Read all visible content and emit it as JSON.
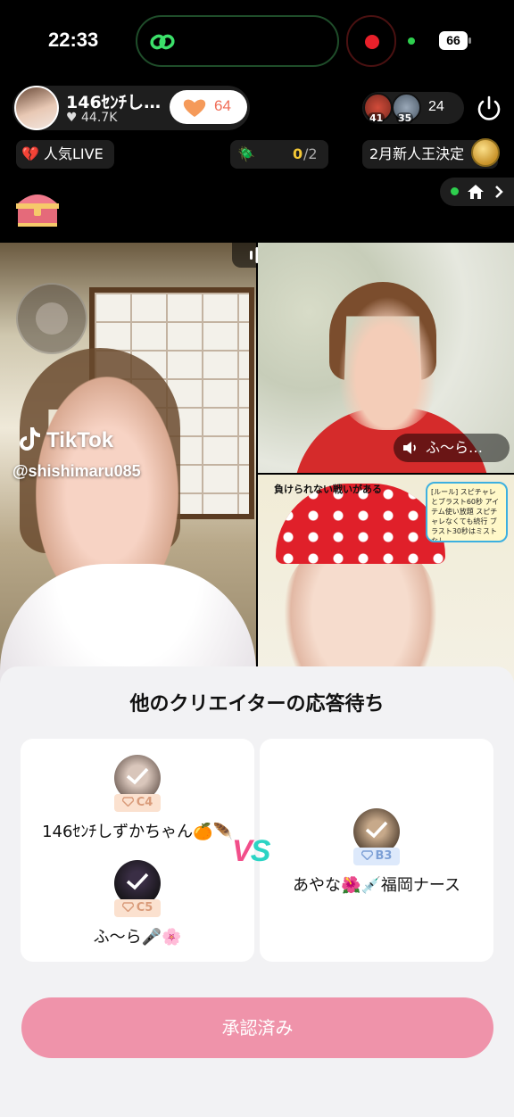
{
  "status_bar": {
    "time": "22:33",
    "battery": "66"
  },
  "host": {
    "name": "146ｾﾝﾁし…",
    "likes": "44.7K",
    "like_count": "64"
  },
  "viewers": {
    "badge1": "41",
    "badge2": "35",
    "count": "24"
  },
  "chips": {
    "popular": "人気LIVE",
    "quest_current": "0",
    "quest_total": "/2",
    "event": "2月新人王決定"
  },
  "video": {
    "watermark": "TikTok",
    "handle": "@shishimaru085",
    "speaker_name": "ふ〜ら…",
    "bottom_banner": "負けられない戦いがある",
    "rules": "[ルール] スピチャレとブラスト60秒 アイテム使い放題 スピチャレなくても続行 ブラスト30秒はミストなし"
  },
  "sheet": {
    "title": "他のクリエイターの応答待ち",
    "team_left": [
      {
        "name": "146ｾﾝﾁしずかちゃん🍊🪶",
        "rank": "C4"
      },
      {
        "name": "ふ〜ら🎤🌸",
        "rank": "C5"
      }
    ],
    "team_right": [
      {
        "name": "あやな🌺💉福岡ナース",
        "rank": "B3"
      }
    ],
    "vs_v": "V",
    "vs_s": "S",
    "approve_button": "承認済み"
  },
  "colors": {
    "accent_pink": "#ef93aa",
    "vs_pink": "#f24e8a",
    "vs_teal": "#2bd4c4",
    "like_orange": "#f06d57"
  }
}
